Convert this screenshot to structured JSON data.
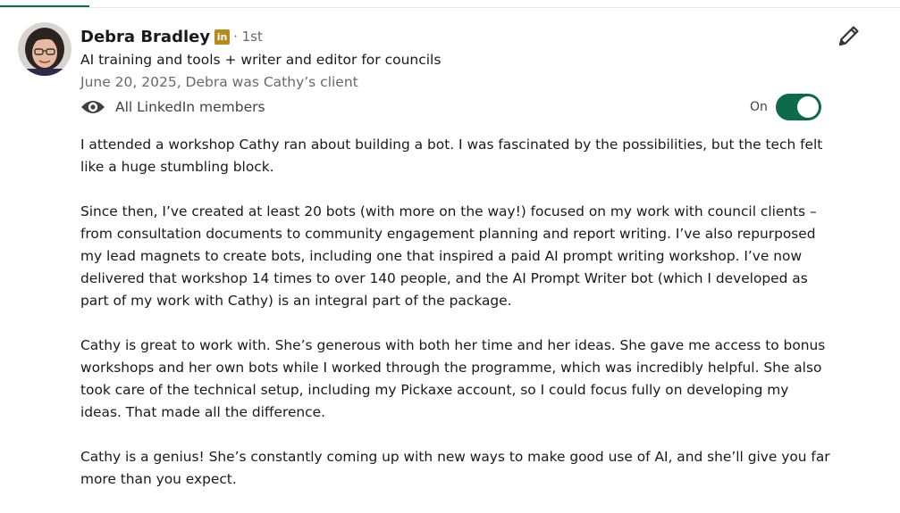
{
  "author": {
    "name": "Debra Bradley",
    "badge": "in",
    "degree": "· 1st",
    "headline": "AI training and tools + writer and editor for councils",
    "meta": "June 20, 2025, Debra was Cathy’s client"
  },
  "visibility": {
    "icon": "eye-icon",
    "label": "All LinkedIn members"
  },
  "toggle": {
    "label": "On",
    "state": "on"
  },
  "edit_icon": "pencil-icon",
  "colors": {
    "toggle_on": "#0b6b48",
    "badge": "#b88a1e",
    "tab_underline": "#0b6b48"
  },
  "recommendation": {
    "paragraphs": [
      "I attended a workshop Cathy ran about building a bot. I was fascinated by the possibilities, but the tech felt like a huge stumbling block.",
      "Since then, I’ve created at least 20 bots (with more on the way!) focused on my work with council clients – from consultation documents to community engagement planning and report writing. I’ve also repurposed my lead magnets to create bots, including one that inspired a paid AI prompt writing workshop. I’ve now delivered that workshop 14 times to over 140 people, and the AI Prompt Writer bot (which I developed as part of my work with Cathy) is an integral part of the package.",
      "Cathy is great to work with. She’s generous with both her time and her ideas. She gave me access to bonus workshops and her own bots while I worked through the programme, which was incredibly helpful. She also took care of the technical setup, including my Pickaxe account, so I could focus fully on developing my ideas. That made all the difference.",
      "Cathy is a genius! She’s constantly coming up with new ways to make good use of AI, and she’ll give you far more than you expect."
    ]
  }
}
